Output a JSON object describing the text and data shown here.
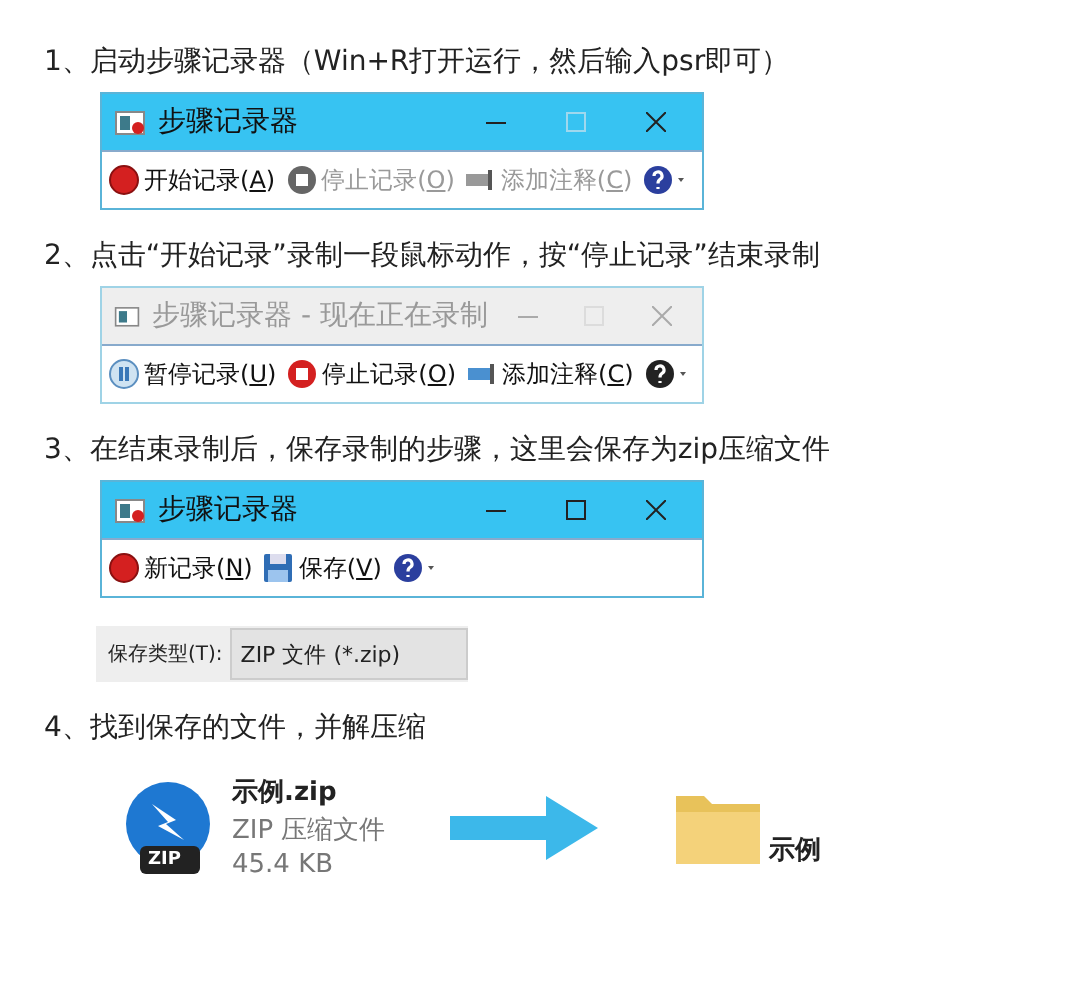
{
  "steps": [
    {
      "text": "1、启动步骤记录器（Win+R打开运行，然后输入psr即可）",
      "window": {
        "title": "步骤记录器",
        "active": true,
        "maximize_disabled": true,
        "buttons": [
          {
            "kind": "record",
            "before": "开始记录(",
            "key": "A",
            "after": ")",
            "disabled": false
          },
          {
            "kind": "stop",
            "before": "停止记录(",
            "key": "O",
            "after": ")",
            "disabled": true
          },
          {
            "kind": "comment",
            "before": "添加注释(",
            "key": "C",
            "after": ")",
            "disabled": true
          },
          {
            "kind": "help"
          }
        ]
      }
    },
    {
      "text": "2、点击“开始记录”录制一段鼠标动作，按“停止记录”结束录制",
      "window": {
        "title": "步骤记录器 - 现在正在录制",
        "active": false,
        "maximize_disabled": true,
        "buttons": [
          {
            "kind": "pause",
            "before": "暂停记录(",
            "key": "U",
            "after": ")",
            "disabled": false
          },
          {
            "kind": "stop",
            "before": "停止记录(",
            "key": "O",
            "after": ")",
            "disabled": false
          },
          {
            "kind": "comment",
            "before": "添加注释(",
            "key": "C",
            "after": ")",
            "disabled": false
          },
          {
            "kind": "help"
          }
        ]
      }
    },
    {
      "text": "3、在结束录制后，保存录制的步骤，这里会保存为zip压缩文件",
      "window": {
        "title": "步骤记录器",
        "active": true,
        "maximize_disabled": false,
        "buttons": [
          {
            "kind": "record",
            "before": "新记录(",
            "key": "N",
            "after": ")",
            "disabled": false
          },
          {
            "kind": "save",
            "before": "保存(",
            "key": "V",
            "after": ")",
            "disabled": false
          },
          {
            "kind": "help"
          }
        ]
      },
      "save_type": {
        "label": "保存类型(T):",
        "value": "ZIP 文件 (*.zip)"
      }
    },
    {
      "text": "4、找到保存的文件，并解压缩",
      "files": {
        "zip_name": "示例.zip",
        "zip_type": "ZIP 压缩文件",
        "zip_size": "45.4 KB",
        "zip_badge": "ZIP",
        "folder_name": "示例"
      }
    }
  ]
}
